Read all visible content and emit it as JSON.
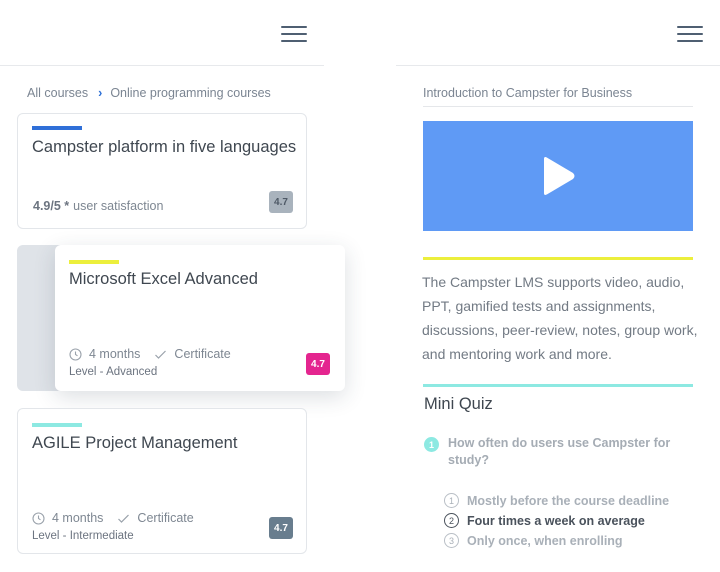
{
  "left_panel": {
    "breadcrumb": {
      "item1": "All courses",
      "separator_icon": "chevron-right-icon",
      "item2": "Online programming courses"
    },
    "courses": [
      {
        "title": "Campster platform in five languages",
        "accent_color": "#2f6fd8",
        "rating_text_bold": "4.9/5 *",
        "rating_text": "user satisfaction",
        "badge": "4.7",
        "badge_color": "#a9b3bd"
      },
      {
        "title": "Microsoft Excel Advanced",
        "accent_color": "#ecef3c",
        "duration": "4 months",
        "certificate": "Certificate",
        "level": "Level - Advanced",
        "badge": "4.7",
        "badge_color": "#e4258f"
      },
      {
        "title": "AGILE Project Management",
        "accent_color": "#8de9e2",
        "duration": "4 months",
        "certificate": "Certificate",
        "level": "Level - Intermediate",
        "badge": "4.7",
        "badge_color": "#687d8e"
      }
    ]
  },
  "right_panel": {
    "course_label": "Introduction to Campster for Business",
    "video_color": "#5f9af5",
    "description": "The Campster LMS supports video, audio, PPT, gamified tests and assignments, discussions, peer-review, notes, group work, and mentoring work and more.",
    "quiz": {
      "title": "Mini Quiz",
      "question_number": "1",
      "question": "How often do users use Campster for study?",
      "options": [
        {
          "number": "1",
          "label": "Mostly before the course deadline",
          "selected": false
        },
        {
          "number": "2",
          "label": "Four times a week on average",
          "selected": true
        },
        {
          "number": "3",
          "label": "Only once, when enrolling",
          "selected": false
        }
      ]
    }
  }
}
